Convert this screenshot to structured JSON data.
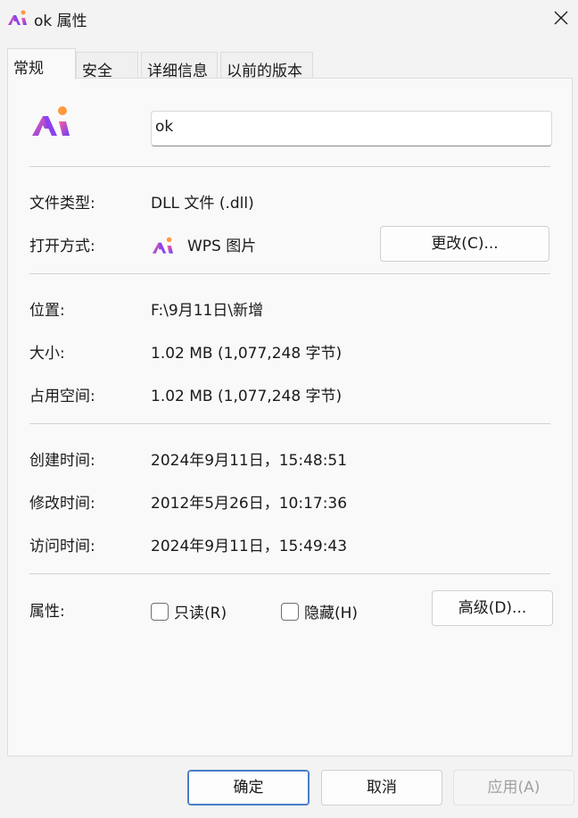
{
  "window": {
    "title": "ok 属性",
    "title_icon": "wps-logo-icon",
    "close_icon": "close-icon"
  },
  "tabs": [
    {
      "label": "常规",
      "active": true
    },
    {
      "label": "安全",
      "active": false
    },
    {
      "label": "详细信息",
      "active": false
    },
    {
      "label": "以前的版本",
      "active": false
    }
  ],
  "general": {
    "file_icon": "wps-logo-icon",
    "name_value": "ok",
    "file_type_label": "文件类型:",
    "file_type_value": "DLL 文件 (.dll)",
    "open_with_label": "打开方式:",
    "open_with_value": "WPS 图片",
    "open_with_icon": "wps-logo-icon",
    "change_button": "更改(C)...",
    "location_label": "位置:",
    "location_value": "F:\\9月11日\\新增",
    "size_label": "大小:",
    "size_value": "1.02 MB (1,077,248 字节)",
    "disk_size_label": "占用空间:",
    "disk_size_value": "1.02 MB (1,077,248 字节)",
    "created_label": "创建时间:",
    "created_value": "2024年9月11日，15:48:51",
    "modified_label": "修改时间:",
    "modified_value": "2012年5月26日，10:17:36",
    "accessed_label": "访问时间:",
    "accessed_value": "2024年9月11日，15:49:43",
    "attributes_label": "属性:",
    "readonly_label": "只读(R)",
    "readonly_checked": false,
    "hidden_label": "隐藏(H)",
    "hidden_checked": false,
    "advanced_button": "高级(D)..."
  },
  "footer": {
    "ok": "确定",
    "cancel": "取消",
    "apply": "应用(A)"
  },
  "colors": {
    "accent": "#4a7dc7",
    "logo_pink": "#f05aa0",
    "logo_purple": "#7a3cf0",
    "logo_orange": "#ff9a3c"
  }
}
